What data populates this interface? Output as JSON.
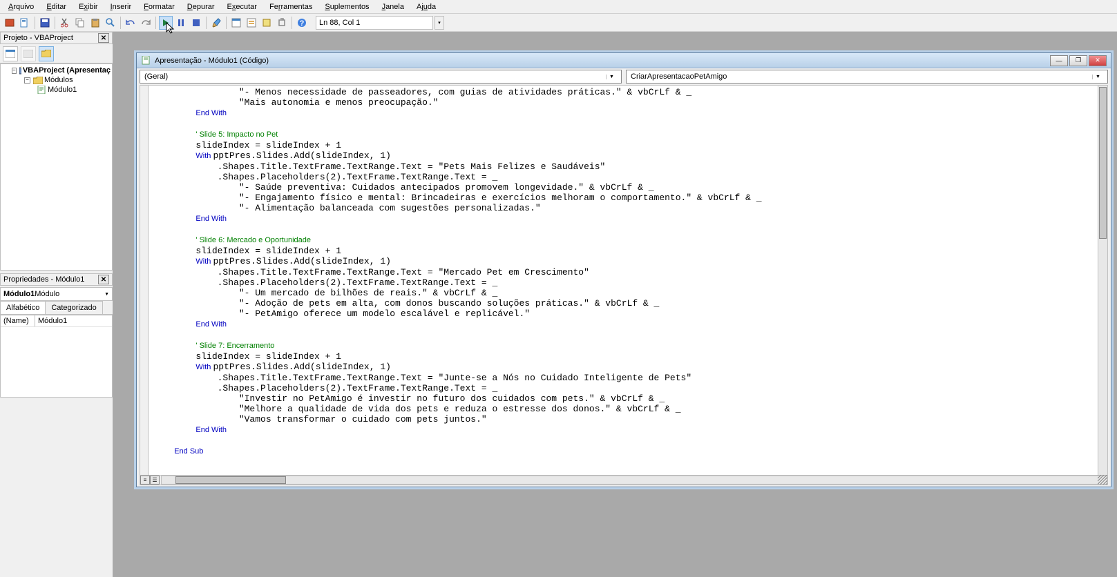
{
  "menu": {
    "arquivo": "Arquivo",
    "editar": "Editar",
    "exibir": "Exibir",
    "inserir": "Inserir",
    "formatar": "Formatar",
    "depurar": "Depurar",
    "executar": "Executar",
    "ferramentas": "Ferramentas",
    "suplementos": "Suplementos",
    "janela": "Janela",
    "ajuda": "Ajuda"
  },
  "status": "Ln 88, Col 1",
  "project_panel": {
    "title": "Projeto - VBAProject",
    "root": "VBAProject (Apresentaç",
    "folder": "Módulos",
    "module": "Módulo1"
  },
  "properties_panel": {
    "title": "Propriedades - Módulo1",
    "combo_bold": "Módulo1",
    "combo_type": " Módulo",
    "tab_alpha": "Alfabético",
    "tab_cat": "Categorizado",
    "prop_name": "(Name)",
    "prop_val": "Módulo1"
  },
  "code_window": {
    "title": "Apresentação - Módulo1 (Código)",
    "left_combo": "(Geral)",
    "right_combo": "CriarApresentacaoPetAmigo"
  },
  "code_lines": [
    {
      "i": 16,
      "t": "\"- Menos necessidade de passeadores, com guias de atividades práticas.\" & vbCrLf & _"
    },
    {
      "i": 16,
      "t": "\"Mais autonomia e menos preocupação.\""
    },
    {
      "i": 8,
      "k": "End With"
    },
    {
      "i": 0,
      "t": ""
    },
    {
      "i": 8,
      "c": "' Slide 5: Impacto no Pet"
    },
    {
      "i": 8,
      "t": "slideIndex = slideIndex + 1"
    },
    {
      "i": 8,
      "pre": "With ",
      "t": "pptPres.Slides.Add(slideIndex, 1)"
    },
    {
      "i": 12,
      "t": ".Shapes.Title.TextFrame.TextRange.Text = \"Pets Mais Felizes e Saudáveis\""
    },
    {
      "i": 12,
      "t": ".Shapes.Placeholders(2).TextFrame.TextRange.Text = _"
    },
    {
      "i": 16,
      "t": "\"- Saúde preventiva: Cuidados antecipados promovem longevidade.\" & vbCrLf & _"
    },
    {
      "i": 16,
      "t": "\"- Engajamento físico e mental: Brincadeiras e exercícios melhoram o comportamento.\" & vbCrLf & _"
    },
    {
      "i": 16,
      "t": "\"- Alimentação balanceada com sugestões personalizadas.\""
    },
    {
      "i": 8,
      "k": "End With"
    },
    {
      "i": 0,
      "t": ""
    },
    {
      "i": 8,
      "c": "' Slide 6: Mercado e Oportunidade"
    },
    {
      "i": 8,
      "t": "slideIndex = slideIndex + 1"
    },
    {
      "i": 8,
      "pre": "With ",
      "t": "pptPres.Slides.Add(slideIndex, 1)"
    },
    {
      "i": 12,
      "t": ".Shapes.Title.TextFrame.TextRange.Text = \"Mercado Pet em Crescimento\""
    },
    {
      "i": 12,
      "t": ".Shapes.Placeholders(2).TextFrame.TextRange.Text = _"
    },
    {
      "i": 16,
      "t": "\"- Um mercado de bilhões de reais.\" & vbCrLf & _"
    },
    {
      "i": 16,
      "t": "\"- Adoção de pets em alta, com donos buscando soluções práticas.\" & vbCrLf & _"
    },
    {
      "i": 16,
      "t": "\"- PetAmigo oferece um modelo escalável e replicável.\""
    },
    {
      "i": 8,
      "k": "End With"
    },
    {
      "i": 0,
      "t": ""
    },
    {
      "i": 8,
      "c": "' Slide 7: Encerramento"
    },
    {
      "i": 8,
      "t": "slideIndex = slideIndex + 1"
    },
    {
      "i": 8,
      "pre": "With ",
      "t": "pptPres.Slides.Add(slideIndex, 1)"
    },
    {
      "i": 12,
      "t": ".Shapes.Title.TextFrame.TextRange.Text = \"Junte-se a Nós no Cuidado Inteligente de Pets\""
    },
    {
      "i": 12,
      "t": ".Shapes.Placeholders(2).TextFrame.TextRange.Text = _"
    },
    {
      "i": 16,
      "t": "\"Investir no PetAmigo é investir no futuro dos cuidados com pets.\" & vbCrLf & _"
    },
    {
      "i": 16,
      "t": "\"Melhore a qualidade de vida dos pets e reduza o estresse dos donos.\" & vbCrLf & _"
    },
    {
      "i": 16,
      "t": "\"Vamos transformar o cuidado com pets juntos.\""
    },
    {
      "i": 8,
      "k": "End With"
    },
    {
      "i": 0,
      "t": ""
    },
    {
      "i": 4,
      "k": "End Sub"
    },
    {
      "i": 4,
      "t": ""
    }
  ]
}
